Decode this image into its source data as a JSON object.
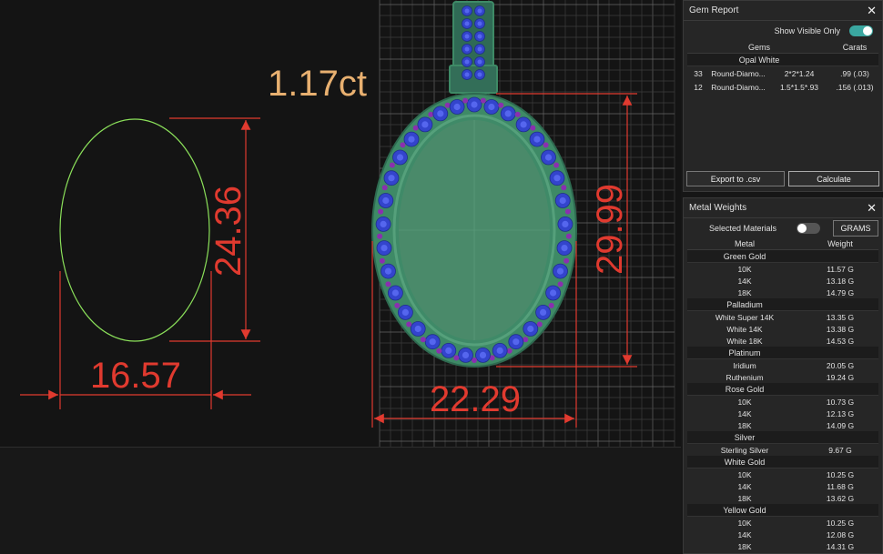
{
  "canvas": {
    "carat_label": "1.17ct",
    "dim_oval_height": "24.36",
    "dim_oval_width": "16.57",
    "dim_pendant_height": "29.99",
    "dim_pendant_width": "22.29",
    "colors": {
      "dimension": "#e03a2f",
      "oval_outline": "#8be05a",
      "carat_text": "#e8b070",
      "metal": "#3e8a66",
      "stone": "#3344cc",
      "accent_stone": "#8a2fb0"
    }
  },
  "gem_report": {
    "title": "Gem Report",
    "show_visible_label": "Show Visible Only",
    "show_visible_on": true,
    "col_gems": "Gems",
    "col_carats": "Carats",
    "group": "Opal White",
    "rows": [
      {
        "qty": "33",
        "shape": "Round-Diamo...",
        "size": "2*2*1.24",
        "carats": ".99 (.03)"
      },
      {
        "qty": "12",
        "shape": "Round-Diamo...",
        "size": "1.5*1.5*.93",
        "carats": ".156 (.013)"
      }
    ],
    "export_label": "Export to .csv",
    "calculate_label": "Calculate"
  },
  "metal_weights": {
    "title": "Metal Weights",
    "selected_materials_label": "Selected Materials",
    "selected_materials_on": false,
    "units_label": "GRAMS",
    "col_metal": "Metal",
    "col_weight": "Weight",
    "groups": [
      {
        "name": "Green Gold",
        "items": [
          {
            "metal": "10K",
            "weight": "11.57 G"
          },
          {
            "metal": "14K",
            "weight": "13.18 G"
          },
          {
            "metal": "18K",
            "weight": "14.79 G"
          }
        ]
      },
      {
        "name": "Palladium",
        "items": [
          {
            "metal": "White Super 14K",
            "weight": "13.35 G"
          },
          {
            "metal": "White 14K",
            "weight": "13.38 G"
          },
          {
            "metal": "White 18K",
            "weight": "14.53 G"
          }
        ]
      },
      {
        "name": "Platinum",
        "items": [
          {
            "metal": "Iridium",
            "weight": "20.05 G"
          },
          {
            "metal": "Ruthenium",
            "weight": "19.24 G"
          }
        ]
      },
      {
        "name": "Rose Gold",
        "items": [
          {
            "metal": "10K",
            "weight": "10.73 G"
          },
          {
            "metal": "14K",
            "weight": "12.13 G"
          },
          {
            "metal": "18K",
            "weight": "14.09 G"
          }
        ]
      },
      {
        "name": "Silver",
        "items": [
          {
            "metal": "Sterling Silver",
            "weight": "9.67 G"
          }
        ]
      },
      {
        "name": "White Gold",
        "items": [
          {
            "metal": "10K",
            "weight": "10.25 G"
          },
          {
            "metal": "14K",
            "weight": "11.68 G"
          },
          {
            "metal": "18K",
            "weight": "13.62 G"
          }
        ]
      },
      {
        "name": "Yellow Gold",
        "items": [
          {
            "metal": "10K",
            "weight": "10.25 G"
          },
          {
            "metal": "14K",
            "weight": "12.08 G"
          },
          {
            "metal": "18K",
            "weight": "14.31 G"
          }
        ]
      }
    ]
  }
}
